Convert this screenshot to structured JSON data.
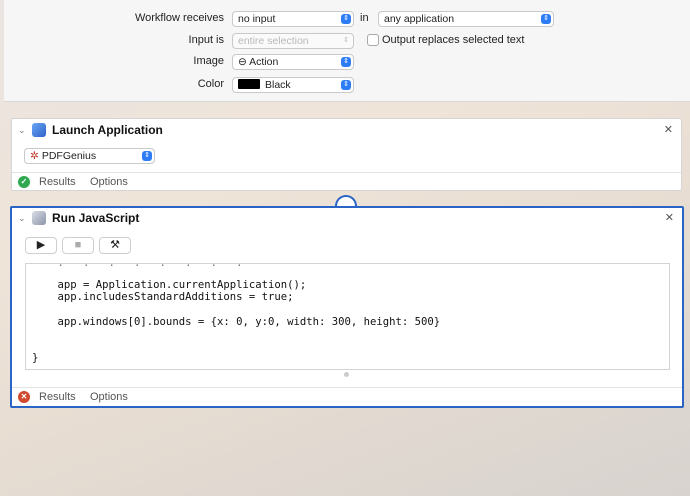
{
  "header": {
    "workflow_receives_label": "Workflow receives",
    "workflow_receives_value": "no input",
    "in_label": "in",
    "in_value": "any application",
    "input_is_label": "Input is",
    "input_is_value": "entire selection",
    "output_replaces_label": "Output replaces selected text",
    "image_label": "Image",
    "image_value": "⊖ Action",
    "color_label": "Color",
    "color_value": "Black",
    "color_swatch": "#000000"
  },
  "launch_app": {
    "title": "Launch Application",
    "app_value": "PDFGenius",
    "results_label": "Results",
    "options_label": "Options",
    "status": "success"
  },
  "run_js": {
    "title": "Run JavaScript",
    "toolbar": {
      "run_icon": "play-icon",
      "stop_icon": "stop-icon",
      "compile_icon": "hammer-icon"
    },
    "code_lines": [
      "    app = Application.currentApplication();",
      "    app.includesStandardAdditions = true;",
      "",
      "    app.windows[0].bounds = {x: 0, y:0, width: 300, height: 500}",
      "",
      "",
      "}"
    ],
    "results_label": "Results",
    "options_label": "Options",
    "status": "error"
  },
  "colors": {
    "accent": "#2e7cf6",
    "selection_border": "#2a64c5",
    "success": "#2fa84f",
    "error": "#d24a2d"
  }
}
